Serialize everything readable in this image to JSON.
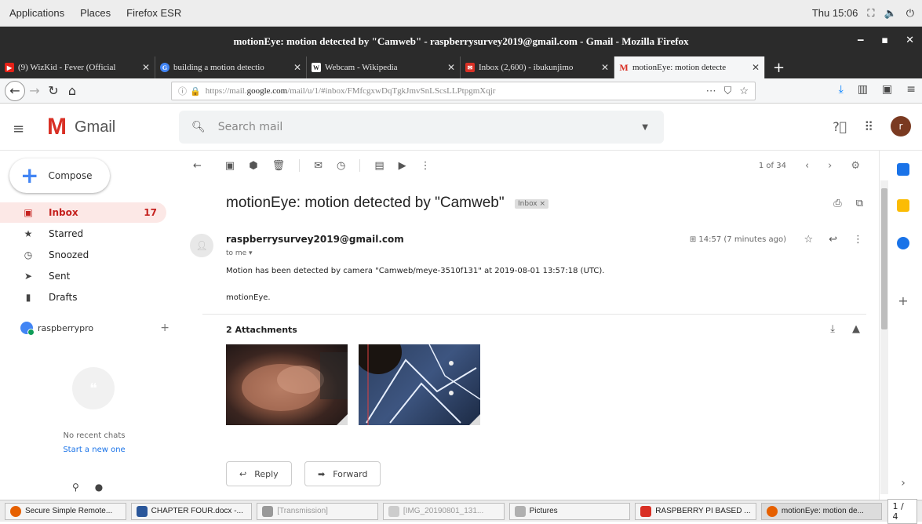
{
  "system_bar": {
    "applications": "Applications",
    "places": "Places",
    "firefox": "Firefox ESR",
    "clock": "Thu 15:06"
  },
  "window": {
    "title": "motionEye: motion detected by \"Camweb\" - raspberrysurvey2019@gmail.com - Gmail - Mozilla Firefox"
  },
  "tabs": [
    {
      "label": "(9) WizKid - Fever (Official",
      "color": "#e62117"
    },
    {
      "label": "building a motion detectio",
      "color": "#4285f4"
    },
    {
      "label": "Webcam - Wikipedia",
      "color": "#555555"
    },
    {
      "label": "Inbox (2,600) - ibukunjimo",
      "color": "#d93025"
    },
    {
      "label": "motionEye: motion detecte",
      "color": "#d93025"
    }
  ],
  "browser": {
    "url_prefix": "https://mail.",
    "url_domain": "google.com",
    "url_path": "/mail/u/1/#inbox/FMfcgxwDqTgkJmvSnLScsLLPtpgmXqjr"
  },
  "gmail": {
    "brand": "Gmail",
    "search_placeholder": "Search mail",
    "avatar_letter": "r",
    "compose": "Compose",
    "nav": [
      {
        "label": "Inbox",
        "count": "17",
        "icon": "inbox-icon"
      },
      {
        "label": "Starred",
        "count": "",
        "icon": "star-icon"
      },
      {
        "label": "Snoozed",
        "count": "",
        "icon": "clock-icon"
      },
      {
        "label": "Sent",
        "count": "",
        "icon": "send-icon"
      },
      {
        "label": "Drafts",
        "count": "",
        "icon": "draft-icon"
      }
    ],
    "hangouts_user": "raspberrypro",
    "no_chats": "No recent chats",
    "start_new": "Start a new one",
    "pagination": "1 of 34",
    "subject": "motionEye: motion detected by \"Camweb\"",
    "label_badge": "Inbox ×",
    "sender": "raspberrysurvey2019@gmail.com",
    "to": "to me ▾",
    "time": "14:57 (7 minutes ago)",
    "body_line1": "Motion has been detected by camera \"Camweb/meye-3510f131\" at 2019-08-01 13:57:18 (UTC).",
    "body_line2": "motionEye.",
    "attachments_title": "2 Attachments",
    "reply": "Reply",
    "forward": "Forward"
  },
  "taskbar": [
    {
      "label": "Secure Simple Remote...",
      "color": "#e66000",
      "dim": false
    },
    {
      "label": "CHAPTER FOUR.docx -...",
      "color": "#2b579a",
      "dim": false
    },
    {
      "label": "[Transmission]",
      "color": "#999999",
      "dim": true
    },
    {
      "label": "[IMG_20190801_131...",
      "color": "#aaaaaa",
      "dim": true
    },
    {
      "label": "Pictures",
      "color": "#b0b0b0",
      "dim": false
    },
    {
      "label": "RASPBERRY PI BASED ...",
      "color": "#d93025",
      "dim": false
    },
    {
      "label": "motionEye: motion de...",
      "color": "#e66000",
      "dim": false
    }
  ],
  "taskbar_pager": "1 / 4"
}
